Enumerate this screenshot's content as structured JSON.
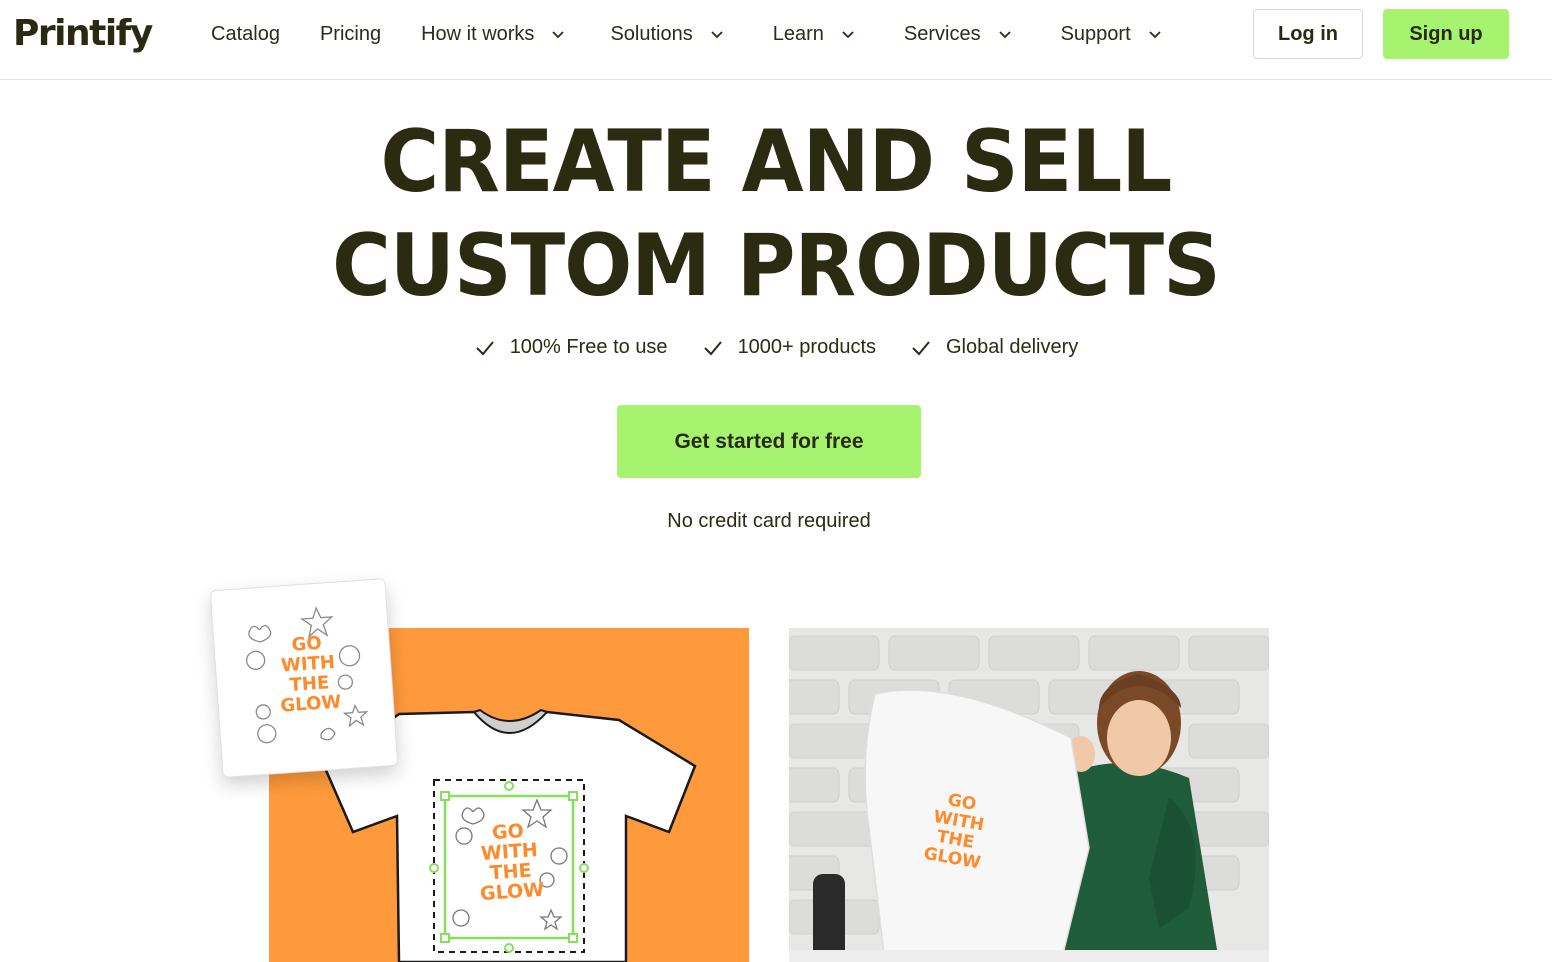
{
  "header": {
    "logo_text": "Printify",
    "nav": [
      {
        "label": "Catalog",
        "has_dropdown": false
      },
      {
        "label": "Pricing",
        "has_dropdown": false
      },
      {
        "label": "How it works",
        "has_dropdown": true
      },
      {
        "label": "Solutions",
        "has_dropdown": true
      },
      {
        "label": "Learn",
        "has_dropdown": true
      },
      {
        "label": "Services",
        "has_dropdown": true
      },
      {
        "label": "Support",
        "has_dropdown": true
      }
    ],
    "login_label": "Log in",
    "signup_label": "Sign up"
  },
  "hero": {
    "title_line1": "CREATE AND SELL",
    "title_line2": "CUSTOM PRODUCTS",
    "features": [
      "100% Free to use",
      "1000+ products",
      "Global delivery"
    ],
    "cta_label": "Get started for free",
    "cta_note": "No credit card required"
  },
  "artwork": {
    "design_text": [
      "GO",
      "WITH",
      "THE",
      "GLOW"
    ]
  },
  "colors": {
    "accent_green": "#a6f36f",
    "panel_orange": "#ff9a3c",
    "dark_text": "#2b2b12",
    "sweater_green": "#1f5c3a"
  }
}
